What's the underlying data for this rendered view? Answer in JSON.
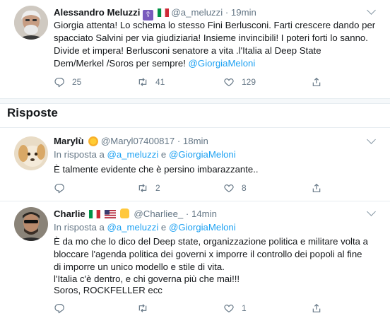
{
  "main_tweet": {
    "name": "Alessandro Meluzzi",
    "handle": "@a_meluzzi",
    "sep": "·",
    "time": "19min",
    "lines": [
      "Giorgia attenta! Lo schema lo stesso Fini Berlusconi. Farti crescere dando per",
      "spacciato Salvini per via giudiziaria! Insieme invincibili! I poteri forti lo sanno.",
      "Divide et impera! Berlusconi senatore a vita .l'Italia al Deep State",
      "Dem/Merkel /Soros per sempre! "
    ],
    "mention": "@GiorgiaMeloni",
    "reply_count": "25",
    "retweet_count": "41",
    "like_count": "129"
  },
  "section": {
    "title": "Risposte"
  },
  "replies": [
    {
      "name": "Marylù",
      "handle": "@Maryl07400817",
      "sep": "·",
      "time": "18min",
      "in_reply_prefix": "In risposta a ",
      "in_reply_user1": "@a_meluzzi",
      "in_reply_and": " e ",
      "in_reply_user2": "@GiorgiaMeloni",
      "lines": [
        "È talmente evidente che è persino imbarazzante.."
      ],
      "reply_count": "",
      "retweet_count": "2",
      "like_count": "8"
    },
    {
      "name": "Charlie",
      "handle": "@Charliee_",
      "sep": "·",
      "time": "14min",
      "in_reply_prefix": "In risposta a ",
      "in_reply_user1": "@a_meluzzi",
      "in_reply_and": " e ",
      "in_reply_user2": "@GiorgiaMeloni",
      "lines": [
        "È da mo che lo dico del Deep state, organizzazione politica e militare volta a",
        "bloccare l'agenda politica dei governi x imporre il controllo dei popoli al fine",
        "di imporre un unico modello e stile di vita.",
        "l'Italia c'è dentro, e chi governa più che mai!!!",
        "Soros, ROCKFELLER ecc"
      ],
      "reply_count": "",
      "retweet_count": "",
      "like_count": "1"
    }
  ],
  "colors": {
    "link": "#1da1f2",
    "meta": "#657786",
    "border": "#e6ecf0"
  }
}
